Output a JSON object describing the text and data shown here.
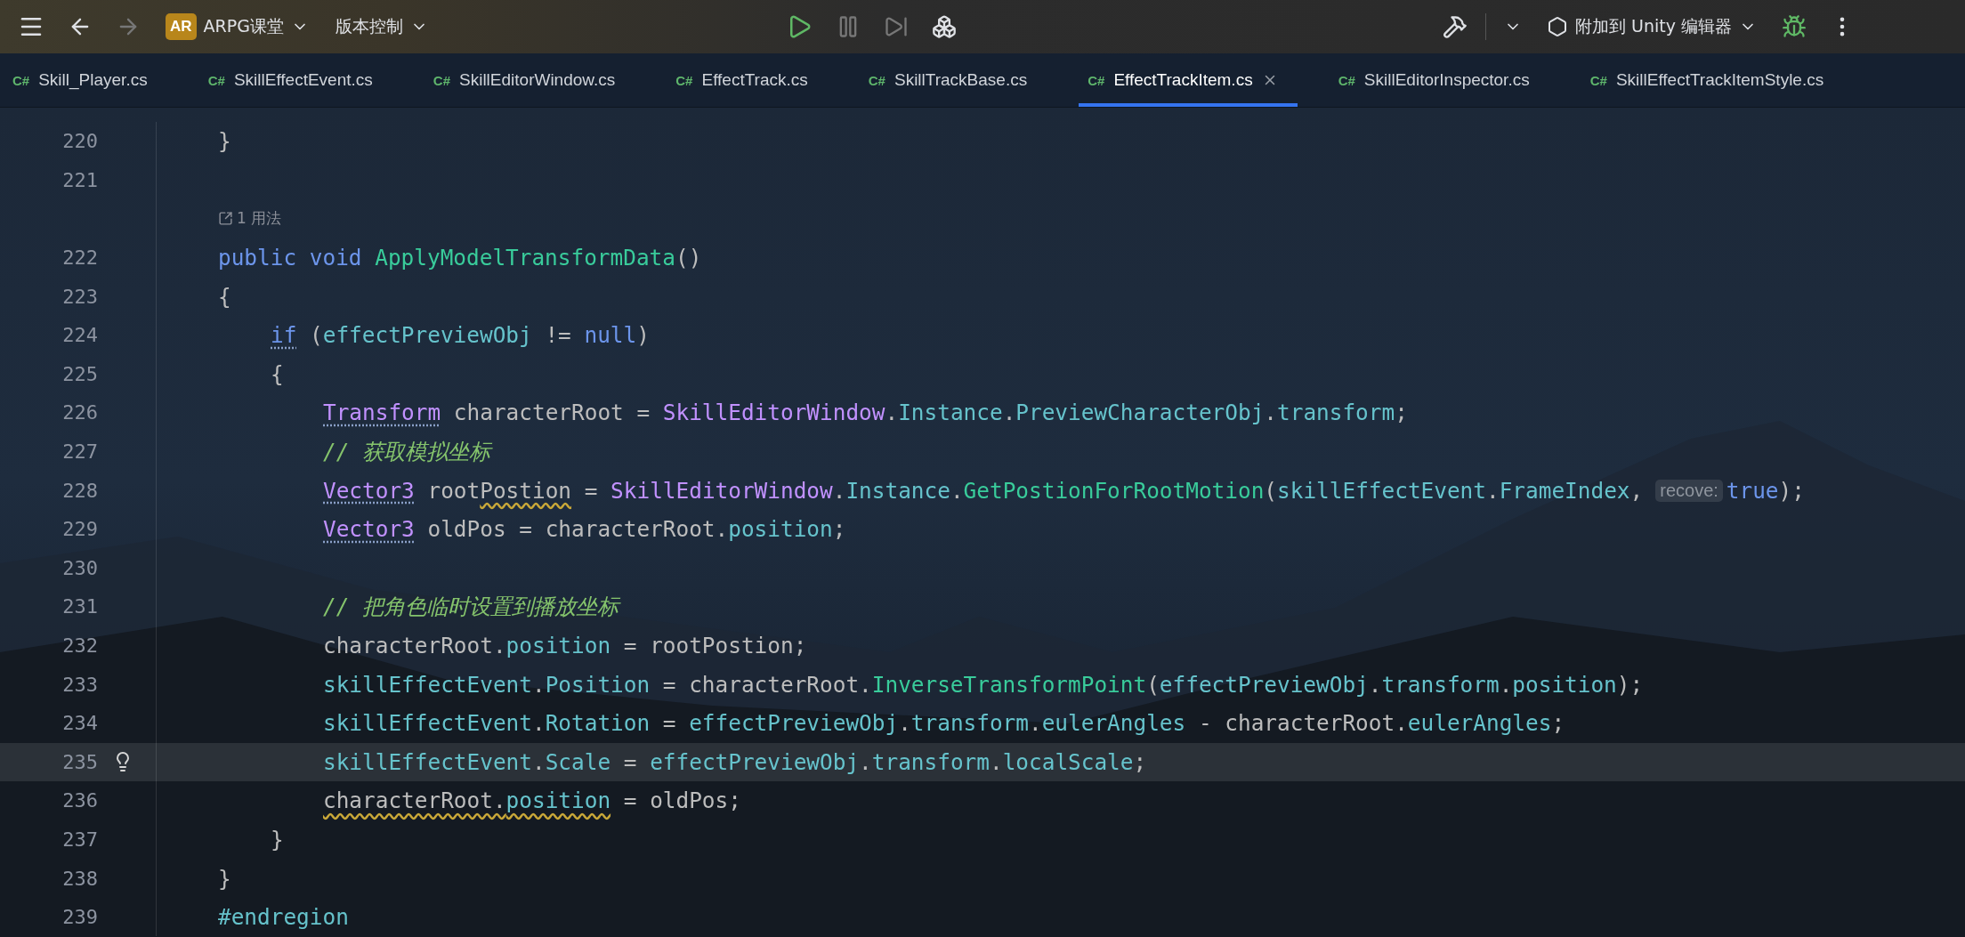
{
  "toolbar": {
    "project_badge": "AR",
    "project": "ARPG课堂",
    "vcs": "版本控制",
    "run_config": "附加到 Unity 编辑器"
  },
  "tabs": [
    {
      "badge": "C#",
      "label": "Skill_Player.cs",
      "selected": false
    },
    {
      "badge": "C#",
      "label": "SkillEffectEvent.cs",
      "selected": false
    },
    {
      "badge": "C#",
      "label": "SkillEditorWindow.cs",
      "selected": false
    },
    {
      "badge": "C#",
      "label": "EffectTrack.cs",
      "selected": false
    },
    {
      "badge": "C#",
      "label": "SkillTrackBase.cs",
      "selected": false
    },
    {
      "badge": "C#",
      "label": "EffectTrackItem.cs",
      "selected": true
    },
    {
      "badge": "C#",
      "label": "SkillEditorInspector.cs",
      "selected": false
    },
    {
      "badge": "C#",
      "label": "SkillEffectTrackItemStyle.cs",
      "selected": false
    }
  ],
  "editor": {
    "lines": [
      {
        "kind": "code",
        "number": "220",
        "current": false,
        "tokens": [
          {
            "t": "}",
            "kind": "plain"
          }
        ]
      },
      {
        "kind": "code",
        "number": "221",
        "current": false
      },
      {
        "kind": "usages",
        "text": "1 用法"
      },
      {
        "kind": "code",
        "number": "222",
        "current": false,
        "tokens": [
          {
            "t": "public void ",
            "kind": "kw"
          },
          {
            "t": "ApplyModelTransformData",
            "kind": "method"
          },
          {
            "t": "()",
            "kind": "plain"
          }
        ]
      },
      {
        "kind": "code",
        "number": "223",
        "current": false,
        "tokens": [
          {
            "t": "{",
            "kind": "plain"
          }
        ],
        "children": [
          {
            "kind": "code",
            "number": "224",
            "current": false,
            "tokens": [
              {
                "t": "if",
                "kind": "kw",
                "dotted": true
              },
              {
                "t": " (",
                "kind": "plain"
              },
              {
                "t": "effectPreviewObj",
                "kind": "field"
              },
              {
                "t": " != ",
                "kind": "plain"
              },
              {
                "t": "null",
                "kind": "kw"
              },
              {
                "t": ")",
                "kind": "plain"
              }
            ]
          },
          {
            "kind": "code",
            "number": "225",
            "current": false,
            "tokens": [
              {
                "t": "{",
                "kind": "plain"
              }
            ],
            "children": [
              {
                "kind": "code",
                "number": "226",
                "current": false,
                "tokens": [
                  {
                    "t": "Transform",
                    "kind": "type",
                    "dotted": true
                  },
                  {
                    "t": " characterRoot = ",
                    "kind": "plain"
                  },
                  {
                    "t": "SkillEditorWindow",
                    "kind": "type"
                  },
                  {
                    "t": ".",
                    "kind": "plain"
                  },
                  {
                    "t": "Instance",
                    "kind": "field"
                  },
                  {
                    "t": ".",
                    "kind": "plain"
                  },
                  {
                    "t": "PreviewCharacterObj",
                    "kind": "field"
                  },
                  {
                    "t": ".",
                    "kind": "plain"
                  },
                  {
                    "t": "transform",
                    "kind": "field"
                  },
                  {
                    "t": ";",
                    "kind": "plain"
                  }
                ]
              },
              {
                "kind": "code",
                "number": "227",
                "current": false,
                "tokens": [
                  {
                    "t": "// 获取模拟坐标",
                    "kind": "comment"
                  }
                ]
              },
              {
                "kind": "code",
                "number": "228",
                "current": false,
                "tokens": [
                  {
                    "t": "Vector3",
                    "kind": "type",
                    "dotted": true
                  },
                  {
                    "t": " root",
                    "kind": "plain"
                  },
                  {
                    "t": "Postion",
                    "kind": "plain",
                    "wavy": true
                  },
                  {
                    "t": " = ",
                    "kind": "plain"
                  },
                  {
                    "t": "SkillEditorWindow",
                    "kind": "type"
                  },
                  {
                    "t": ".",
                    "kind": "plain"
                  },
                  {
                    "t": "Instance",
                    "kind": "field"
                  },
                  {
                    "t": ".",
                    "kind": "plain"
                  },
                  {
                    "t": "GetPostionForRootMotion",
                    "kind": "method"
                  },
                  {
                    "t": "(",
                    "kind": "plain"
                  },
                  {
                    "t": "skillEffectEvent",
                    "kind": "field"
                  },
                  {
                    "t": ".",
                    "kind": "plain"
                  },
                  {
                    "t": "FrameIndex",
                    "kind": "field"
                  },
                  {
                    "t": ",",
                    "kind": "plain"
                  },
                  {
                    "t": "recove:",
                    "kind": "hint"
                  },
                  {
                    "t": "true",
                    "kind": "kw"
                  },
                  {
                    "t": ");",
                    "kind": "plain"
                  }
                ]
              },
              {
                "kind": "code",
                "number": "229",
                "current": false,
                "tokens": [
                  {
                    "t": "Vector3",
                    "kind": "type",
                    "dotted": true
                  },
                  {
                    "t": " oldPos = characterRoot.",
                    "kind": "plain"
                  },
                  {
                    "t": "position",
                    "kind": "field"
                  },
                  {
                    "t": ";",
                    "kind": "plain"
                  }
                ]
              },
              {
                "kind": "code",
                "number": "230",
                "current": false
              },
              {
                "kind": "code",
                "number": "231",
                "current": false,
                "tokens": [
                  {
                    "t": "// 把角色临时设置到播放坐标",
                    "kind": "comment"
                  }
                ]
              },
              {
                "kind": "code",
                "number": "232",
                "current": false,
                "tokens": [
                  {
                    "t": "characterRoot.",
                    "kind": "plain"
                  },
                  {
                    "t": "position",
                    "kind": "field"
                  },
                  {
                    "t": " = rootPostion;",
                    "kind": "plain"
                  }
                ]
              },
              {
                "kind": "code",
                "number": "233",
                "current": false,
                "tokens": [
                  {
                    "t": "skillEffectEvent",
                    "kind": "field"
                  },
                  {
                    "t": ".",
                    "kind": "plain"
                  },
                  {
                    "t": "Position",
                    "kind": "field"
                  },
                  {
                    "t": " = characterRoot.",
                    "kind": "plain"
                  },
                  {
                    "t": "InverseTransformPoint",
                    "kind": "method"
                  },
                  {
                    "t": "(",
                    "kind": "plain"
                  },
                  {
                    "t": "effectPreviewObj",
                    "kind": "field"
                  },
                  {
                    "t": ".",
                    "kind": "plain"
                  },
                  {
                    "t": "transform",
                    "kind": "field"
                  },
                  {
                    "t": ".",
                    "kind": "plain"
                  },
                  {
                    "t": "position",
                    "kind": "field"
                  },
                  {
                    "t": ");",
                    "kind": "plain"
                  }
                ]
              },
              {
                "kind": "code",
                "number": "234",
                "current": false,
                "tokens": [
                  {
                    "t": "skillEffectEvent",
                    "kind": "field"
                  },
                  {
                    "t": ".",
                    "kind": "plain"
                  },
                  {
                    "t": "Rotation",
                    "kind": "field"
                  },
                  {
                    "t": " = ",
                    "kind": "plain"
                  },
                  {
                    "t": "effectPreviewObj",
                    "kind": "field"
                  },
                  {
                    "t": ".",
                    "kind": "plain"
                  },
                  {
                    "t": "transform",
                    "kind": "field"
                  },
                  {
                    "t": ".",
                    "kind": "plain"
                  },
                  {
                    "t": "eulerAngles",
                    "kind": "field"
                  },
                  {
                    "t": " - characterRoot.",
                    "kind": "plain"
                  },
                  {
                    "t": "eulerAngles",
                    "kind": "field"
                  },
                  {
                    "t": ";",
                    "kind": "plain"
                  }
                ]
              },
              {
                "kind": "code",
                "number": "235",
                "current": true,
                "bulb": true,
                "tokens": [
                  {
                    "t": "skillEffectEvent",
                    "kind": "field"
                  },
                  {
                    "t": ".",
                    "kind": "plain"
                  },
                  {
                    "t": "Scale",
                    "kind": "field"
                  },
                  {
                    "t": " = ",
                    "kind": "plain"
                  },
                  {
                    "t": "effectPreviewObj",
                    "kind": "field"
                  },
                  {
                    "t": ".",
                    "kind": "plain"
                  },
                  {
                    "t": "transform",
                    "kind": "field"
                  },
                  {
                    "t": ".",
                    "kind": "plain"
                  },
                  {
                    "t": "localScale",
                    "kind": "field"
                  },
                  {
                    "t": ";",
                    "kind": "plain"
                  }
                ]
              },
              {
                "kind": "code",
                "number": "236",
                "current": false,
                "tokens": [
                  {
                    "t": "characterRoot.",
                    "kind": "plain",
                    "wavy": true
                  },
                  {
                    "t": "position",
                    "kind": "field",
                    "wavy": true
                  },
                  {
                    "t": " = oldPos;",
                    "kind": "plain"
                  }
                ]
              }
            ]
          },
          {
            "kind": "code",
            "number": "237",
            "current": false,
            "tokens": [
              {
                "t": "}",
                "kind": "plain"
              }
            ]
          }
        ]
      },
      {
        "kind": "code",
        "number": "238",
        "current": false,
        "tokens": [
          {
            "t": "}",
            "kind": "plain"
          }
        ]
      },
      {
        "kind": "code",
        "number": "239",
        "current": false,
        "tokens": [
          {
            "t": "#endregion",
            "kind": "preproc"
          }
        ]
      }
    ]
  }
}
